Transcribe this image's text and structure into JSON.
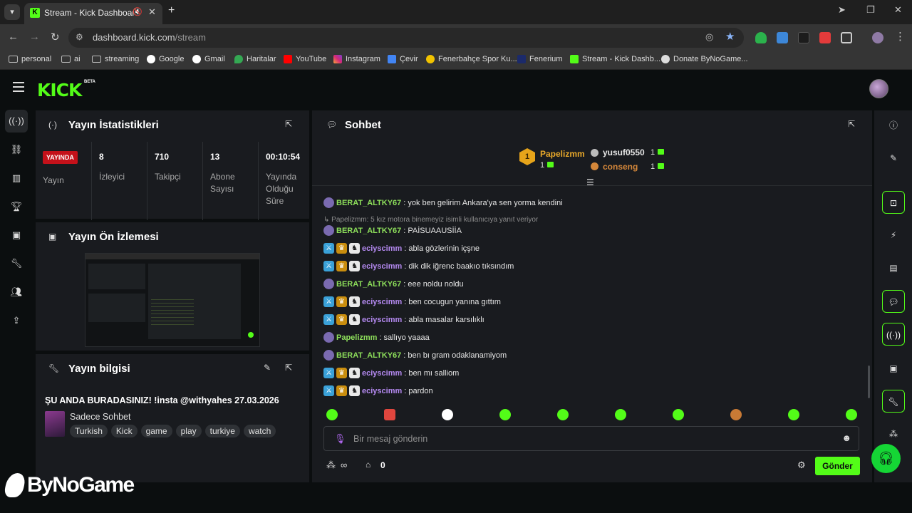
{
  "browser": {
    "tab_title": "Stream - Kick Dashboard",
    "url_host": "dashboard.kick.com",
    "url_path": "/stream",
    "bookmarks": [
      "personal",
      "ai",
      "streaming",
      "Google",
      "Gmail",
      "Haritalar",
      "YouTube",
      "Instagram",
      "Çevir",
      "Fenerbahçe Spor Ku...",
      "Fenerium",
      "Stream - Kick Dashb...",
      "Donate ByNoGame..."
    ]
  },
  "app": {
    "logo": "KICK",
    "logo_badge": "BETA"
  },
  "stats": {
    "title": "Yayın İstatistikleri",
    "live_badge": "YAYINDA",
    "live_label": "Yayın",
    "viewers_value": "8",
    "viewers_label": "İzleyici",
    "followers_value": "710",
    "followers_label": "Takipçi",
    "subs_value": "13",
    "subs_label": "Abone Sayısı",
    "duration_value": "00:10:54",
    "duration_label": "Yayında Olduğu Süre"
  },
  "preview": {
    "title": "Yayın Ön İzlemesi"
  },
  "info": {
    "title": "Yayın bilgisi",
    "stream_title": "ŞU ANDA BURADASINIZ! !insta @withyahes 27.03.2026",
    "category": "Sadece Sohbet",
    "tags": [
      "Turkish",
      "Kick",
      "game",
      "play",
      "turkiye",
      "watch"
    ]
  },
  "chat": {
    "title": "Sohbet",
    "leaderboard": {
      "first_rank": "1",
      "first_name": "Papelizmm",
      "first_count": "1",
      "second_name": "yusuf0550",
      "second_count": "1",
      "third_name": "conseng",
      "third_count": "1"
    },
    "reply_context": "Papelizmm: 5 kız motora binemeyiz isimli kullanıcıya yanıt veriyor",
    "messages": [
      {
        "user": "BERAT_ALTKY67",
        "text": "yok ben gelirim Ankara'ya sen yorma kendini"
      },
      {
        "user": "BERAT_ALTKY67",
        "text": "PAİSUAAUSİİA"
      },
      {
        "user": "eciyscimm",
        "text": "abla gözlerinin içşne"
      },
      {
        "user": "eciyscimm",
        "text": "dik dik iğrenc baakıo tıksındım"
      },
      {
        "user": "BERAT_ALTKY67",
        "text": "eee noldu noldu"
      },
      {
        "user": "eciyscimm",
        "text": "ben cocugun yanına gıttım"
      },
      {
        "user": "eciyscimm",
        "text": "abla masalar karsılıklı"
      },
      {
        "user": "Papelizmm",
        "text": "sallıyo yaaaa"
      },
      {
        "user": "BERAT_ALTKY67",
        "text": "ben bı gram odaklanamiyom"
      },
      {
        "user": "eciyscimm",
        "text": "ben mı salliom"
      },
      {
        "user": "eciyscimm",
        "text": "pardon"
      }
    ],
    "input_placeholder": "Bir mesaj gönderin",
    "points_value": "∞",
    "store_value": "0",
    "send_label": "Gönder"
  },
  "watermark": "ByNoGame",
  "colors": {
    "kick_green": "#53fc18",
    "live_red": "#c4111a",
    "username_green": "#8ee05b",
    "username_purple": "#b489f0"
  }
}
